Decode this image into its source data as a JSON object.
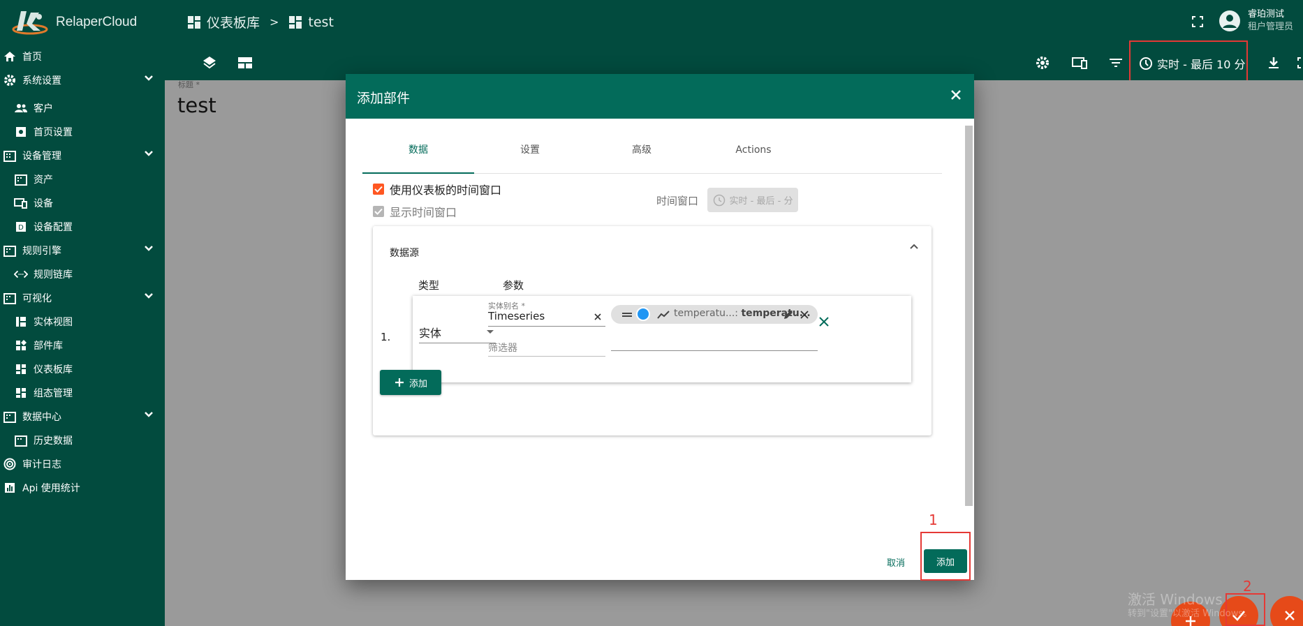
{
  "app": {
    "name": "RelaperCloud"
  },
  "breadcrumb": [
    {
      "label": "仪表板库"
    },
    {
      "label": "test"
    }
  ],
  "breadcrumb_separator": ">",
  "user": {
    "name": "睿珀测试",
    "role": "租户管理员"
  },
  "toolbar": {
    "timewindow_label": "实时 - 最后 10 分"
  },
  "sidebar": {
    "items": [
      {
        "label": "首页",
        "icon": "home-icon"
      },
      {
        "label": "系统设置",
        "icon": "gear-icon",
        "expandable": true
      },
      {
        "label": "客户",
        "icon": "people-icon"
      },
      {
        "label": "首页设置",
        "icon": "settings-box-icon"
      },
      {
        "label": "设备管理",
        "icon": "building-icon",
        "expandable": true
      },
      {
        "label": "资产",
        "icon": "building-icon"
      },
      {
        "label": "设备",
        "icon": "devices-icon"
      },
      {
        "label": "设备配置",
        "icon": "device-profile-icon"
      },
      {
        "label": "规则引擎",
        "icon": "building-icon",
        "expandable": true
      },
      {
        "label": "规则链库",
        "icon": "code-icon"
      },
      {
        "label": "可视化",
        "icon": "building-icon",
        "expandable": true
      },
      {
        "label": "实体视图",
        "icon": "view-icon"
      },
      {
        "label": "部件库",
        "icon": "widgets-icon"
      },
      {
        "label": "仪表板库",
        "icon": "dashboard-icon"
      },
      {
        "label": "组态管理",
        "icon": "dashboard-icon"
      },
      {
        "label": "数据中心",
        "icon": "building-icon",
        "expandable": true
      },
      {
        "label": "历史数据",
        "icon": "history-icon"
      },
      {
        "label": "审计日志",
        "icon": "audit-icon"
      },
      {
        "label": "Api 使用统计",
        "icon": "chart-icon"
      }
    ]
  },
  "dashboard": {
    "title_label": "标题 *",
    "title": "test"
  },
  "dialog": {
    "title": "添加部件",
    "tabs": [
      {
        "label": "数据"
      },
      {
        "label": "设置"
      },
      {
        "label": "高级"
      },
      {
        "label": "Actions"
      }
    ],
    "use_dashboard_timewindow": "使用仪表板的时间窗口",
    "show_timewindow": "显示时间窗口",
    "timewindow_label": "时间窗口",
    "timewindow_value": "实时 - 最后 - 分",
    "datasource": {
      "title": "数据源",
      "col_type": "类型",
      "col_params": "参数",
      "row_index": "1.",
      "type_value": "实体",
      "alias_label": "实体别名 *",
      "alias_value": "Timeseries",
      "filter_placeholder": "筛选器",
      "key_chip": {
        "key_short": "temperatu...",
        "key_label": "temperatu...",
        "separator": ": "
      },
      "add_label": "添加"
    },
    "cancel_label": "取消",
    "confirm_label": "添加"
  },
  "annotations": {
    "num1": "1",
    "num2": "2"
  },
  "watermark": {
    "line1": "激活 Windows",
    "line2": "转到\"设置\"以激活 Windows。"
  },
  "colors": {
    "primary": "#024b3e",
    "accent": "#036b5a",
    "fab": "#e64a19",
    "highlight": "#e53935",
    "checkbox": "#ff5722"
  }
}
